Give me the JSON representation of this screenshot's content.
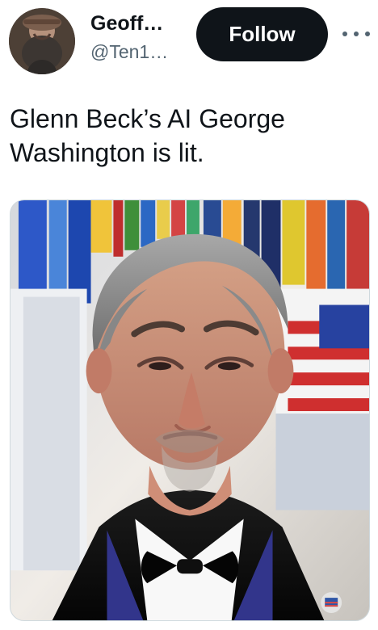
{
  "tweet": {
    "author": {
      "display_name": "Geoff…",
      "handle": "@Ten1…"
    },
    "follow_label": "Follow",
    "more_icon": "more-horizontal-icon",
    "text": "Glenn Beck’s AI George\nWashington is lit.",
    "media": {
      "type": "photo"
    }
  },
  "colors": {
    "text_primary": "#0f1419",
    "text_secondary": "#536471",
    "follow_bg": "#0f1419",
    "follow_text": "#ffffff",
    "border": "#cfd9de"
  }
}
